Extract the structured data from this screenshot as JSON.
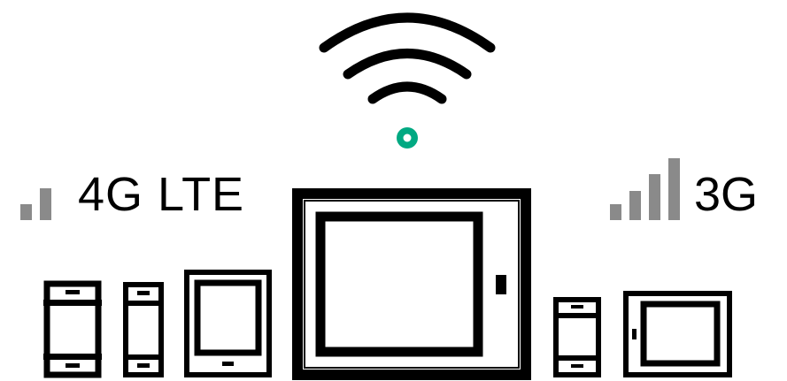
{
  "labels": {
    "left_network": "4G LTE",
    "right_network": "3G"
  },
  "signal": {
    "left_bars_lit": 2,
    "left_bars_total": 2,
    "right_bars_lit": 4,
    "right_bars_total": 4
  },
  "icons": {
    "wifi": "wifi-icon",
    "signal_left": "signal-bars-icon",
    "signal_right": "signal-bars-icon",
    "hotspot": "mobile-hotspot-device-icon",
    "phone": "smartphone-icon",
    "tablet": "tablet-icon"
  },
  "colors": {
    "stroke": "#000000",
    "signal_bars": "#8a8a8a",
    "wifi_dot": "#01a982",
    "background": "#ffffff"
  }
}
